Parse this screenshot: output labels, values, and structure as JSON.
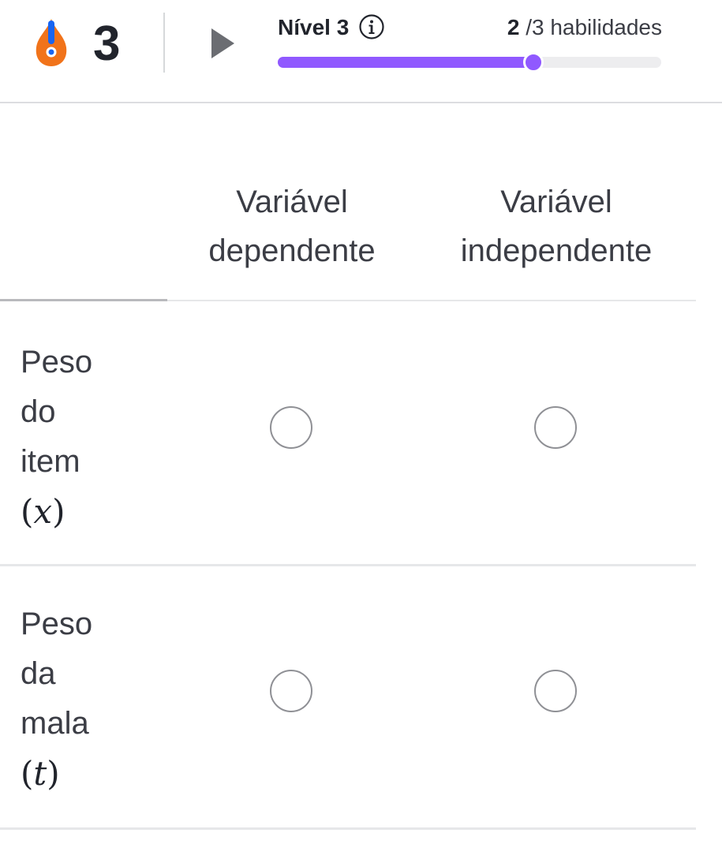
{
  "header": {
    "streak": {
      "icon": "exclamation-shield-icon",
      "icon_color": "#f1731a",
      "icon_accent_color": "#1865f2",
      "count": "3"
    },
    "play_icon": "play-triangle-icon",
    "level": {
      "label": "Nível 3",
      "info_icon": "info-circle-icon"
    },
    "skills": {
      "current": "2",
      "total_text": "/3 habilidades"
    },
    "progress": {
      "fraction": 0.667,
      "fill_color": "#9059ff"
    }
  },
  "matrix": {
    "columns": [
      {
        "line1": "Variável",
        "line2": "dependente"
      },
      {
        "line1": "Variável",
        "line2": "independente"
      }
    ],
    "rows": [
      {
        "words": [
          "Peso",
          "do",
          "item"
        ],
        "math_open": "(",
        "math_var": "x",
        "math_close": ")",
        "selected": null
      },
      {
        "words": [
          "Peso",
          "da",
          "mala"
        ],
        "math_open": "(",
        "math_var": "t",
        "math_close": ")",
        "selected": null
      }
    ]
  }
}
